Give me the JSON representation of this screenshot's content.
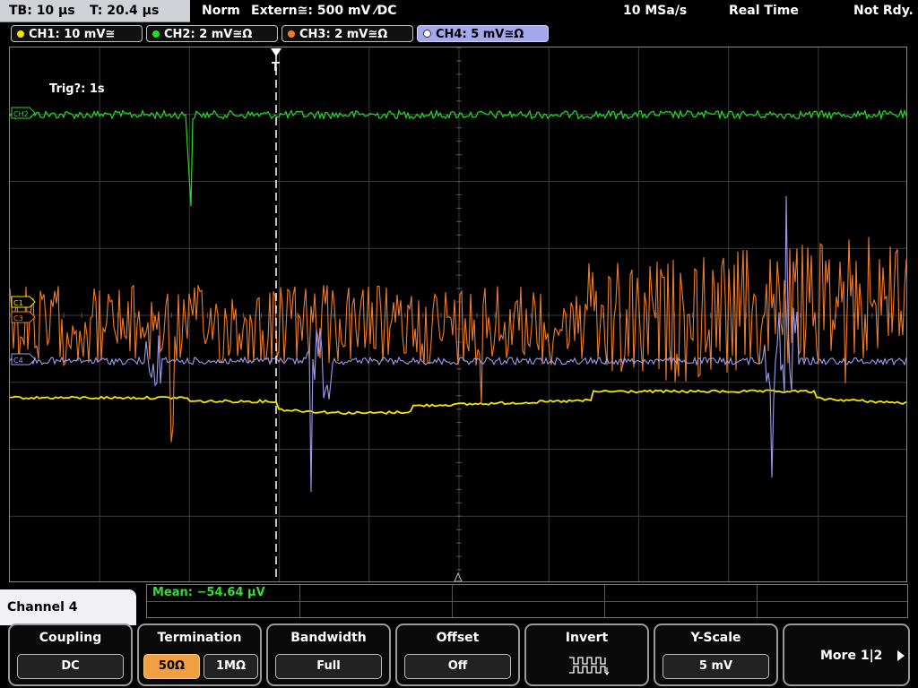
{
  "topbar": {
    "timebase": "TB: 10 µs",
    "trigger_time": "T: 20.4 µs",
    "mode": "Norm",
    "trigger_source": "Extern≅: 500 mV ⁄DC",
    "sample_rate": "10 MSa/s",
    "acq_mode": "Real Time",
    "status": "Not Rdy."
  },
  "channels": [
    {
      "label": "CH1: 10 mV≅",
      "color": "#f2e600"
    },
    {
      "label": "CH2: 2 mV≅Ω",
      "color": "#22dd22"
    },
    {
      "label": "CH3: 2 mV≅Ω",
      "color": "#f07c28"
    },
    {
      "label": "CH4: 5 mV≅Ω",
      "color": "#9e9cf0"
    }
  ],
  "plot": {
    "trig_status": "Trig?: 1s",
    "trigger_marker": "T",
    "marker_ch1": "C1",
    "marker_ch2": "CH2",
    "marker_ch3": "C3",
    "marker_ch4": "C4"
  },
  "measurement": {
    "text": "Mean: −54.64 µV"
  },
  "menu": {
    "title": "Channel 4",
    "coupling": {
      "title": "Coupling",
      "value": "DC"
    },
    "termination": {
      "title": "Termination",
      "opt1": "50Ω",
      "opt2": "1MΩ"
    },
    "bandwidth": {
      "title": "Bandwidth",
      "value": "Full"
    },
    "offset": {
      "title": "Offset",
      "value": "Off"
    },
    "invert": {
      "title": "Invert",
      "icon": "inverted-square-wave-icon"
    },
    "yscale": {
      "title": "Y-Scale",
      "value": "5 mV"
    },
    "more": {
      "label": "More 1|2",
      "icon": "play-arrow-icon"
    }
  }
}
